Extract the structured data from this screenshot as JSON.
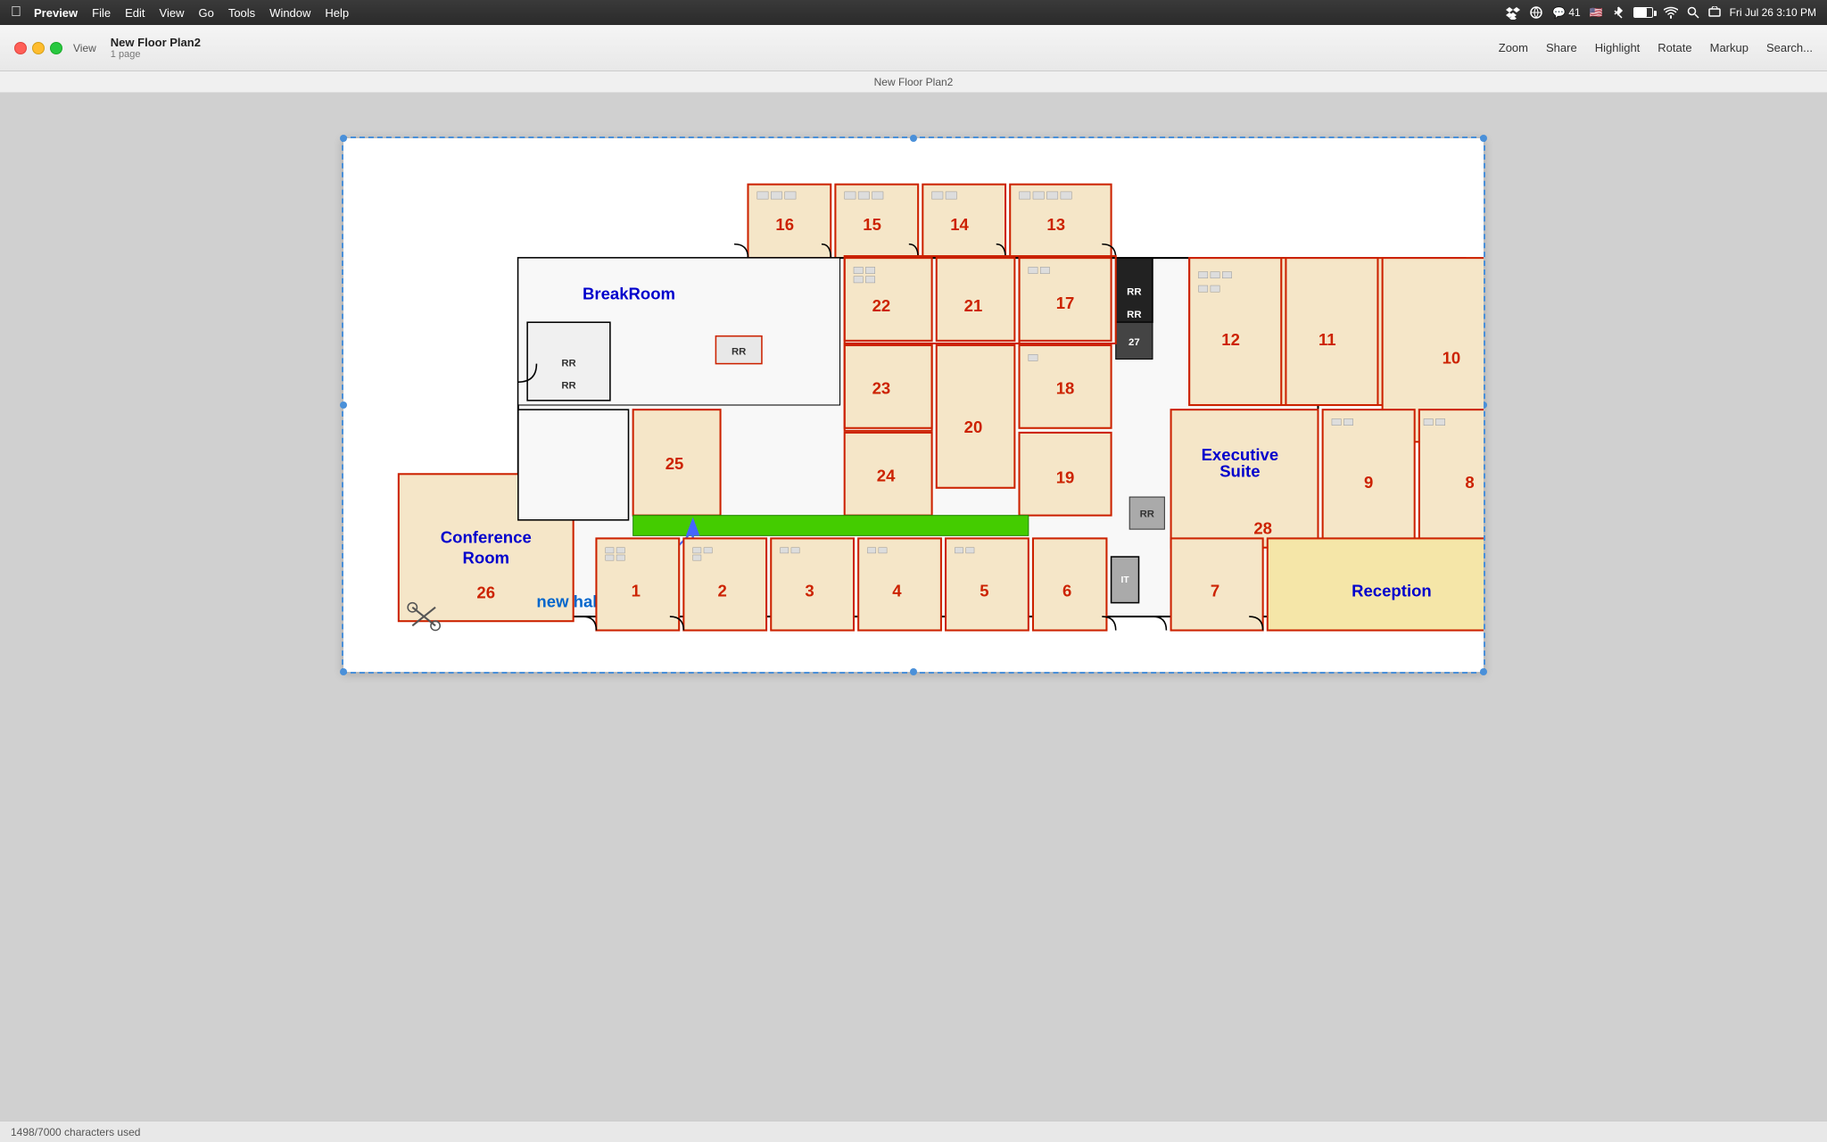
{
  "menubar": {
    "apple": "⌘",
    "items": [
      {
        "label": "Preview",
        "active": true
      },
      {
        "label": "File"
      },
      {
        "label": "Edit"
      },
      {
        "label": "View"
      },
      {
        "label": "Go"
      },
      {
        "label": "Tools"
      },
      {
        "label": "Window"
      },
      {
        "label": "Help"
      }
    ],
    "right": {
      "time": "Fri Jul 26  3:10 PM",
      "wifi": true,
      "battery": true
    }
  },
  "toolbar": {
    "traffic_lights": {
      "close": "close",
      "minimize": "minimize",
      "maximize": "maximize"
    },
    "view_label": "View",
    "file_title": "New Floor Plan2",
    "file_pages": "1 page",
    "buttons": {
      "zoom": "Zoom",
      "share": "Share",
      "highlight": "Highlight",
      "rotate": "Rotate",
      "markup": "Markup",
      "search": "Search..."
    }
  },
  "document": {
    "title": "New Floor Plan2"
  },
  "floor_plan": {
    "rooms": [
      {
        "id": "16",
        "label": "16"
      },
      {
        "id": "15",
        "label": "15"
      },
      {
        "id": "14",
        "label": "14"
      },
      {
        "id": "13",
        "label": "13"
      },
      {
        "id": "22",
        "label": "22"
      },
      {
        "id": "21",
        "label": "21"
      },
      {
        "id": "23",
        "label": "23"
      },
      {
        "id": "20",
        "label": "20"
      },
      {
        "id": "24",
        "label": "24"
      },
      {
        "id": "25",
        "label": "25"
      },
      {
        "id": "17",
        "label": "17"
      },
      {
        "id": "18",
        "label": "18"
      },
      {
        "id": "19",
        "label": "19"
      },
      {
        "id": "27",
        "label": "27"
      },
      {
        "id": "12",
        "label": "12"
      },
      {
        "id": "11",
        "label": "11"
      },
      {
        "id": "10",
        "label": "10"
      },
      {
        "id": "9",
        "label": "9"
      },
      {
        "id": "8",
        "label": "8"
      },
      {
        "id": "executive_suite",
        "label": "Executive Suite"
      },
      {
        "id": "28",
        "label": "28"
      },
      {
        "id": "breakroom",
        "label": "BreakRoom"
      },
      {
        "id": "conference_room",
        "label": "Conference Room"
      },
      {
        "id": "26",
        "label": "26"
      },
      {
        "id": "1",
        "label": "1"
      },
      {
        "id": "2",
        "label": "2"
      },
      {
        "id": "3",
        "label": "3"
      },
      {
        "id": "4",
        "label": "4"
      },
      {
        "id": "5",
        "label": "5"
      },
      {
        "id": "6",
        "label": "6"
      },
      {
        "id": "7",
        "label": "7"
      },
      {
        "id": "reception",
        "label": "Reception"
      }
    ],
    "annotations": {
      "new_hallway": "new hallway"
    }
  },
  "status_bar": {
    "chars_used": "1498/7000 characters used"
  }
}
